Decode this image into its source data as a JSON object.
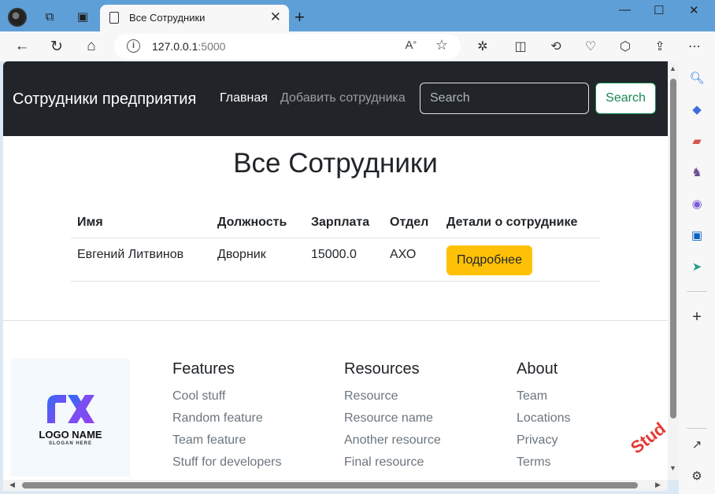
{
  "browser": {
    "tab_title": "Все Сотрудники",
    "url_host": "127.0.0.1",
    "url_port": ":5000"
  },
  "navbar": {
    "brand": "Сотрудники предприятия",
    "link_home": "Главная",
    "link_add": "Добавить сотрудника",
    "search_placeholder": "Search",
    "search_button": "Search"
  },
  "page": {
    "title": "Все Сотрудники"
  },
  "table": {
    "headers": [
      "Имя",
      "Должность",
      "Зарплата",
      "Отдел",
      "Детали о сотруднике"
    ],
    "rows": [
      {
        "name": "Евгений Литвинов",
        "position": "Дворник",
        "salary": "15000.0",
        "department": "АХО",
        "details": "Подробнее"
      }
    ]
  },
  "footer": {
    "logo_name": "LOGO NAME",
    "logo_slogan": "SLOGAN HERE",
    "columns": [
      {
        "title": "Features",
        "links": [
          "Cool stuff",
          "Random feature",
          "Team feature",
          "Stuff for developers"
        ]
      },
      {
        "title": "Resources",
        "links": [
          "Resource",
          "Resource name",
          "Another resource",
          "Final resource"
        ]
      },
      {
        "title": "About",
        "links": [
          "Team",
          "Locations",
          "Privacy",
          "Terms"
        ]
      }
    ]
  },
  "watermark": "Stud",
  "colors": {
    "navbar_bg": "#212529",
    "success": "#198754",
    "warning": "#ffc107",
    "muted": "#6c757d",
    "tabbar": "#5f9fd8"
  }
}
